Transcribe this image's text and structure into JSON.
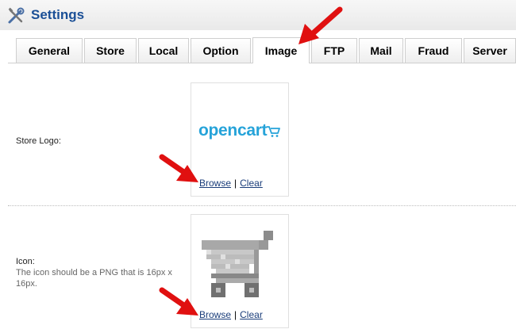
{
  "header": {
    "title": "Settings",
    "icon": "settings-tools-icon"
  },
  "tabs": [
    {
      "label": "General"
    },
    {
      "label": "Store"
    },
    {
      "label": "Local"
    },
    {
      "label": "Option"
    },
    {
      "label": "Image",
      "active": true
    },
    {
      "label": "FTP"
    },
    {
      "label": "Mail"
    },
    {
      "label": "Fraud"
    },
    {
      "label": "Server"
    }
  ],
  "store_logo": {
    "label": "Store Logo:",
    "logo_text": "opencart",
    "browse": "Browse",
    "separator": "|",
    "clear": "Clear"
  },
  "icon_field": {
    "label": "Icon:",
    "help": "The icon should be a PNG that is 16px x 16px.",
    "browse": "Browse",
    "separator": "|",
    "clear": "Clear"
  },
  "colors": {
    "title": "#1a4f96",
    "logo": "#26a3d9",
    "arrow": "#e01010",
    "link": "#1a3d7a"
  }
}
